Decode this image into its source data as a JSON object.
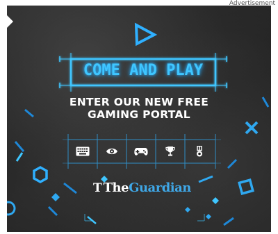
{
  "ad_label": "Advertisement",
  "ad": {
    "banner_text": "COME AND PLAY",
    "headline_line1": "ENTER OUR NEW FREE",
    "headline_line2": "GAMING PORTAL",
    "icons": [
      "keyboard-icon",
      "eye-icon",
      "gamepad-icon",
      "trophy-icon",
      "medal-icon"
    ],
    "brand_mark": "T",
    "brand_the": "The",
    "brand_guardian": "Guardian",
    "colors": {
      "accent": "#3fc6ff",
      "accent_dark": "#1e88d8",
      "brand_blue": "#3fa8e8",
      "background": "#1f1f1f",
      "text": "#ffffff"
    }
  }
}
